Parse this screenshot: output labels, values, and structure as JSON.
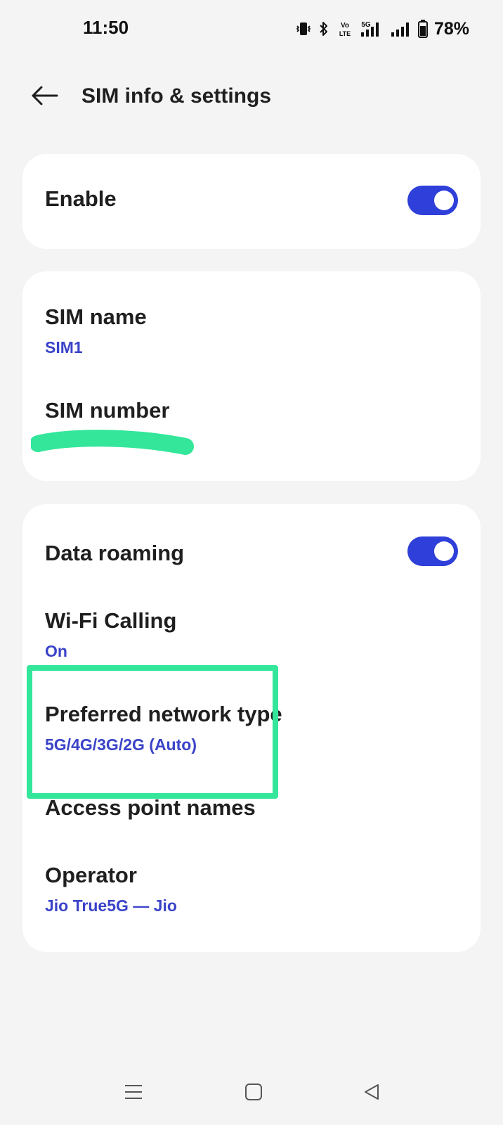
{
  "status_bar": {
    "time": "11:50",
    "icons": [
      "vibrate-icon",
      "bluetooth-icon",
      "volte-icon",
      "5g-signal-icon",
      "signal-icon",
      "battery-icon"
    ],
    "volte_label": "VoLTE",
    "network_label": "5G",
    "battery_percent": "78%"
  },
  "header": {
    "back_icon": "arrow-left-icon",
    "title": "SIM info & settings"
  },
  "enable_card": {
    "label": "Enable",
    "toggle_on": true
  },
  "sim_card": {
    "name_label": "SIM name",
    "name_value": "SIM1",
    "number_label": "SIM number"
  },
  "network_card": {
    "data_roaming_label": "Data roaming",
    "data_roaming_on": true,
    "wifi_calling_label": "Wi-Fi Calling",
    "wifi_calling_value": "On",
    "preferred_network_label": "Preferred network type",
    "preferred_network_value": "5G/4G/3G/2G (Auto)",
    "apn_label": "Access point names",
    "operator_label": "Operator",
    "operator_value": "Jio True5G — Jio"
  },
  "nav_bar": {
    "recents_icon": "menu-lines-icon",
    "home_icon": "square-home-icon",
    "back_icon": "triangle-back-icon"
  },
  "colors": {
    "background": "#f4f4f4",
    "card": "#ffffff",
    "accent": "#2f3fd9",
    "subtext": "#3a43c8",
    "annotation": "#33e69a"
  }
}
